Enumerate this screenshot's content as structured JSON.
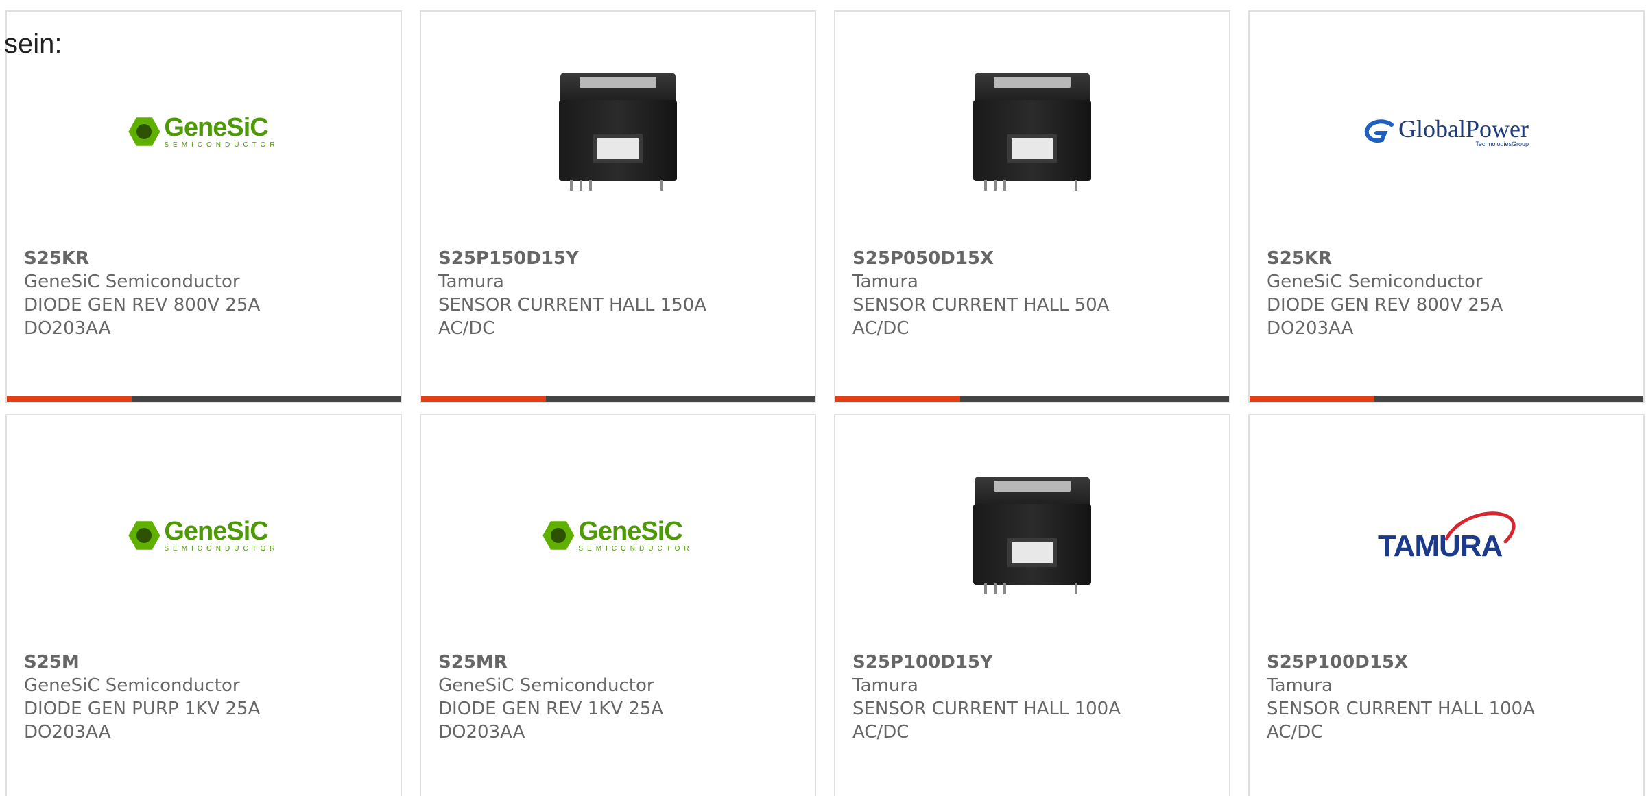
{
  "intro_text": "sein:",
  "brand_colors": {
    "accent_bar": "#e43d12",
    "dark_bar": "#444444",
    "text_gray": "#666666"
  },
  "cards": [
    {
      "part_number": "S25KR",
      "manufacturer": "GeneSiC Semiconductor",
      "desc_line1": "DIODE GEN REV 800V 25A",
      "desc_line2": "DO203AA",
      "image": "genesic-logo",
      "logo_text": "GeneSiC",
      "logo_subtext": "SEMICONDUCTOR"
    },
    {
      "part_number": "S25P150D15Y",
      "manufacturer": "Tamura",
      "desc_line1": "SENSOR CURRENT HALL 150A",
      "desc_line2": "AC/DC",
      "image": "current-sensor-photo"
    },
    {
      "part_number": "S25P050D15X",
      "manufacturer": "Tamura",
      "desc_line1": "SENSOR CURRENT HALL 50A",
      "desc_line2": "AC/DC",
      "image": "current-sensor-photo"
    },
    {
      "part_number": "S25KR",
      "manufacturer": "GeneSiC Semiconductor",
      "desc_line1": "DIODE GEN REV 800V 25A",
      "desc_line2": "DO203AA",
      "image": "globalpower-logo",
      "logo_text": "GlobalPower",
      "logo_subtext": "TechnologiesGroup"
    },
    {
      "part_number": "S25M",
      "manufacturer": "GeneSiC Semiconductor",
      "desc_line1": "DIODE GEN PURP 1KV 25A",
      "desc_line2": "DO203AA",
      "image": "genesic-logo",
      "logo_text": "GeneSiC",
      "logo_subtext": "SEMICONDUCTOR"
    },
    {
      "part_number": "S25MR",
      "manufacturer": "GeneSiC Semiconductor",
      "desc_line1": "DIODE GEN REV 1KV 25A",
      "desc_line2": "DO203AA",
      "image": "genesic-logo",
      "logo_text": "GeneSiC",
      "logo_subtext": "SEMICONDUCTOR"
    },
    {
      "part_number": "S25P100D15Y",
      "manufacturer": "Tamura",
      "desc_line1": "SENSOR CURRENT HALL 100A",
      "desc_line2": "AC/DC",
      "image": "current-sensor-photo"
    },
    {
      "part_number": "S25P100D15X",
      "manufacturer": "Tamura",
      "desc_line1": "SENSOR CURRENT HALL 100A",
      "desc_line2": "AC/DC",
      "image": "tamura-logo",
      "logo_text": "TAMURA"
    }
  ]
}
